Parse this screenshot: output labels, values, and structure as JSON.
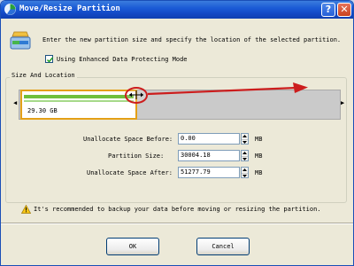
{
  "window": {
    "title": "Move/Resize Partition",
    "help_glyph": "?",
    "close_glyph": "✕",
    "app_icon": "partition-app-icon"
  },
  "header": {
    "icon": "partition-disk-icon",
    "instruction": "Enter the new partition size and specify the location of the selected partition."
  },
  "protect_option": {
    "label": "Using Enhanced Data Protecting Mode",
    "checked": true
  },
  "size_location": {
    "group_title": "Size And Location",
    "partition_label": "29.30 GB",
    "left_arrow": "◀",
    "right_arrow": "▶"
  },
  "fields": {
    "before": {
      "label": "Unallocate Space Before:",
      "value": "0.00",
      "unit": "MB"
    },
    "size": {
      "label": "Partition Size:",
      "value": "30004.18",
      "unit": "MB"
    },
    "after": {
      "label": "Unallocate Space After:",
      "value": "51277.79",
      "unit": "MB"
    }
  },
  "warning": {
    "icon": "warning-icon",
    "text": "It's recommended to backup your data before moving or resizing the partition."
  },
  "buttons": {
    "ok": "OK",
    "cancel": "Cancel"
  },
  "colors": {
    "titlebar": "#1b5bd6",
    "partition_border": "#e4a017",
    "partition_used": "#6fbf3c",
    "annotation_red": "#cc1d1d",
    "track": "#cacaca"
  }
}
